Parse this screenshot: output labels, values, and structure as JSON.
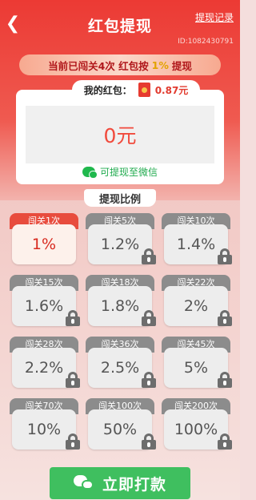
{
  "header": {
    "title": "红包提现",
    "record_link": "提现记录",
    "uid": "ID:1082430791",
    "back_icon": "chevron-left-icon"
  },
  "banner": {
    "prefix": "当前已闯关4次 红包按",
    "percent": "1%",
    "suffix": "提现"
  },
  "wallet": {
    "label": "我的红包：",
    "amount": "0.87元",
    "withdraw_amount": "0元",
    "wechat_text": "可提现至微信"
  },
  "ratio": {
    "title": "提现比例",
    "cards": [
      {
        "stage": "闯关1次",
        "value": "1%",
        "locked": false,
        "active": true
      },
      {
        "stage": "闯关5次",
        "value": "1.2%",
        "locked": true,
        "active": false
      },
      {
        "stage": "闯关10次",
        "value": "1.4%",
        "locked": true,
        "active": false
      },
      {
        "stage": "闯关15次",
        "value": "1.6%",
        "locked": true,
        "active": false
      },
      {
        "stage": "闯关18次",
        "value": "1.8%",
        "locked": true,
        "active": false
      },
      {
        "stage": "闯关22次",
        "value": "2%",
        "locked": true,
        "active": false
      },
      {
        "stage": "闯关28次",
        "value": "2.2%",
        "locked": true,
        "active": false
      },
      {
        "stage": "闯关36次",
        "value": "2.5%",
        "locked": true,
        "active": false
      },
      {
        "stage": "闯关45次",
        "value": "5%",
        "locked": true,
        "active": false
      },
      {
        "stage": "闯关70次",
        "value": "10%",
        "locked": true,
        "active": false
      },
      {
        "stage": "闯关100次",
        "value": "50%",
        "locked": true,
        "active": false
      },
      {
        "stage": "闯关200次",
        "value": "100%",
        "locked": true,
        "active": false
      }
    ]
  },
  "pay_button": {
    "label": "立即打款",
    "icon": "wechat-icon"
  },
  "colors": {
    "primary_red": "#ec3a34",
    "accent_gold": "#e3a300",
    "wechat_green": "#3fbf5f"
  }
}
